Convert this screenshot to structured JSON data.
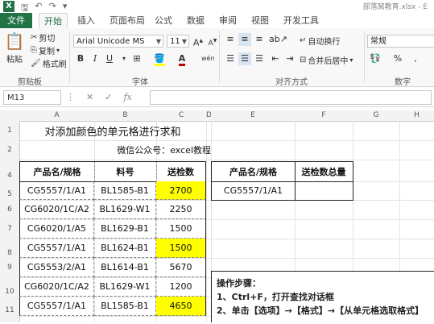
{
  "window": {
    "title": "部落窝教育.xlsx - E"
  },
  "tabs": [
    "文件",
    "开始",
    "插入",
    "页面布局",
    "公式",
    "数据",
    "审阅",
    "视图",
    "开发工具"
  ],
  "clipboard": {
    "paste": "粘贴",
    "cut": "剪切",
    "copy": "复制",
    "format_painter": "格式刷",
    "label": "剪贴板"
  },
  "font": {
    "name": "Arial Unicode MS",
    "size": "11",
    "bold": "B",
    "italic": "I",
    "underline": "U",
    "label": "字体"
  },
  "alignment": {
    "wrap": "自动换行",
    "merge": "合并后居中",
    "label": "对齐方式"
  },
  "number": {
    "format": "常规",
    "label": "数字"
  },
  "formula_bar": {
    "name_box": "M13",
    "fx": "fx",
    "value": ""
  },
  "columns": [
    "A",
    "B",
    "C",
    "D",
    "E",
    "F",
    "G",
    "H"
  ],
  "rows": [
    "1",
    "2",
    "4",
    "5",
    "6",
    "7",
    "8",
    "9",
    "10",
    "11"
  ],
  "sheet": {
    "title": "对添加颜色的单元格进行求和",
    "subtitle": "微信公众号：excel教程",
    "headers": [
      "产品名/规格",
      "料号",
      "送检数"
    ],
    "data": [
      {
        "product": "CG5557/1/A1",
        "part": "BL1585-B1",
        "qty": "2700",
        "highlight": true
      },
      {
        "product": "CG6020/1C/A2",
        "part": "BL1629-W1",
        "qty": "2250",
        "highlight": false
      },
      {
        "product": "CG6020/1/A5",
        "part": "BL1629-B1",
        "qty": "1500",
        "highlight": false
      },
      {
        "product": "CG5557/1/A1",
        "part": "BL1624-B1",
        "qty": "1500",
        "highlight": true
      },
      {
        "product": "CG5553/2/A1",
        "part": "BL1614-B1",
        "qty": "5670",
        "highlight": false
      },
      {
        "product": "CG6020/1C/A2",
        "part": "BL1629-W1",
        "qty": "1200",
        "highlight": false
      },
      {
        "product": "CG5557/1/A1",
        "part": "BL1585-B1",
        "qty": "4650",
        "highlight": true
      }
    ],
    "summary_headers": [
      "产品名/规格",
      "送检数总量"
    ],
    "summary_row": [
      "CG5557/1/A1",
      ""
    ],
    "steps": {
      "title": "操作步骤：",
      "step1": "1、Ctrl+F，打开查找对话框",
      "step2": "2、单击【选项】→【格式】→【从单元格选取格式】"
    }
  },
  "colors": {
    "excel_green": "#217346",
    "highlight": "#ffff00"
  }
}
